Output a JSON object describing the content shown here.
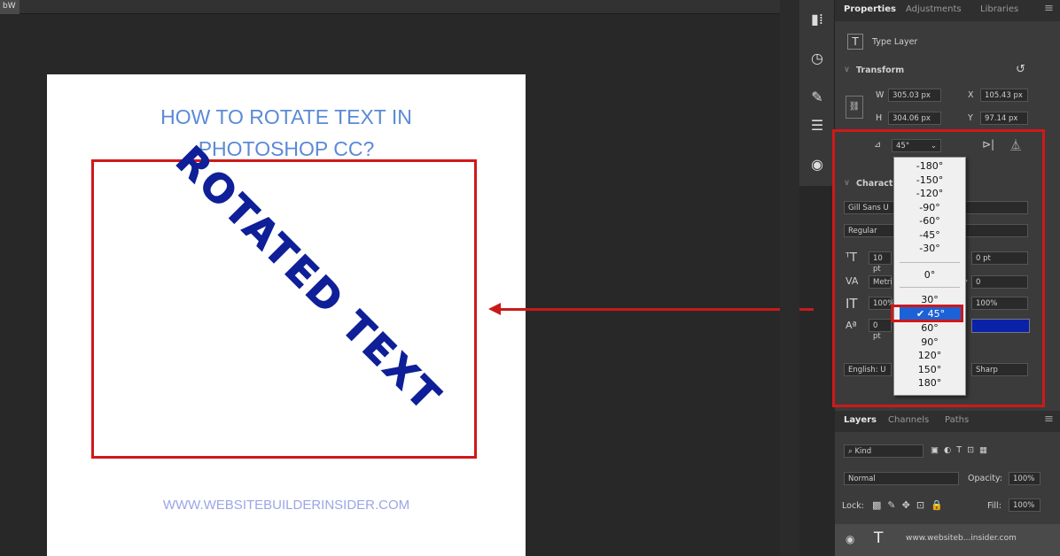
{
  "document": {
    "tab_label": "bW"
  },
  "artboard": {
    "title": "HOW TO ROTATE TEXT IN\nPHOTOSHOP CC?",
    "rotated_text": "ROTATED TEXT",
    "url": "WWW.WEBSITEBUILDERINSIDER.COM"
  },
  "panel_tabs": [
    "Properties",
    "Adjustments",
    "Libraries"
  ],
  "properties": {
    "layer_type": "Type Layer",
    "transform_header": "Transform",
    "w_label": "W",
    "w_value": "305.03 px",
    "x_label": "X",
    "x_value": "105.43 px",
    "h_label": "H",
    "h_value": "304.06 px",
    "y_label": "Y",
    "y_value": "97.14 px",
    "angle_value": "45°",
    "character_header": "Charact",
    "font_family": "Gill Sans U",
    "font_style": "Regular",
    "size_value": "10 pt",
    "leading_value": "0 pt",
    "kerning_value": "Metri",
    "tracking_value": "0",
    "vscale_value": "100%",
    "hscale_value": "100%",
    "baseline_value": "0 pt",
    "language": "English: U",
    "antialias": "Sharp",
    "text_color": "#0a22a8"
  },
  "angle_dropdown": {
    "options": [
      "-180°",
      "-150°",
      "-120°",
      "-90°",
      "-60°",
      "-45°",
      "-30°",
      "0°",
      "30°",
      "45°",
      "60°",
      "90°",
      "120°",
      "150°",
      "180°"
    ],
    "selected": "45°"
  },
  "layers_tabs": [
    "Layers",
    "Channels",
    "Paths"
  ],
  "layers": {
    "search_placeholder": "Kind",
    "blend_mode": "Normal",
    "opacity_label": "Opacity:",
    "opacity_value": "100%",
    "lock_label": "Lock:",
    "fill_label": "Fill:",
    "fill_value": "100%",
    "layer_name": "www.websiteb...insider.com"
  },
  "colors": {
    "accent_red": "#d01818",
    "select_blue": "#1c62d6",
    "title_blue": "#5b8ad6",
    "rotated_blue": "#0f1f98"
  }
}
